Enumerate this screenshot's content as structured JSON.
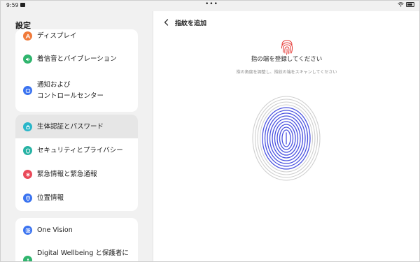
{
  "status_bar": {
    "time": "9:59"
  },
  "left_panel": {
    "title": "設定",
    "group1": [
      {
        "label": "ディスプレイ",
        "color": "#f07a3a"
      },
      {
        "label": "着信音とバイブレーション",
        "color": "#30b56e"
      },
      {
        "label_line1": "通知および",
        "label_line2": "コントロールセンター",
        "color": "#3a73f0"
      }
    ],
    "group2": [
      {
        "label": "生体認証とパスワード",
        "color": "#29b6c9",
        "selected": true
      },
      {
        "label": "セキュリティとプライバシー",
        "color": "#27b2a4"
      },
      {
        "label": "緊急情報と緊急通報",
        "color": "#ea4a5a"
      },
      {
        "label": "位置情報",
        "color": "#3a73f0"
      }
    ],
    "group3": [
      {
        "label": "One Vision",
        "color": "#3a73f0"
      },
      {
        "label": "Digital Wellbeing と保護者に",
        "color": "#30b56e"
      }
    ]
  },
  "right_panel": {
    "title": "指紋を追加",
    "instruction": "指の端を登録してください",
    "sub_instruction": "指の角度を調整し、指紋の端をスキャンしてください",
    "accent_red": "#e53935",
    "accent_blue": "#4a52e0"
  }
}
